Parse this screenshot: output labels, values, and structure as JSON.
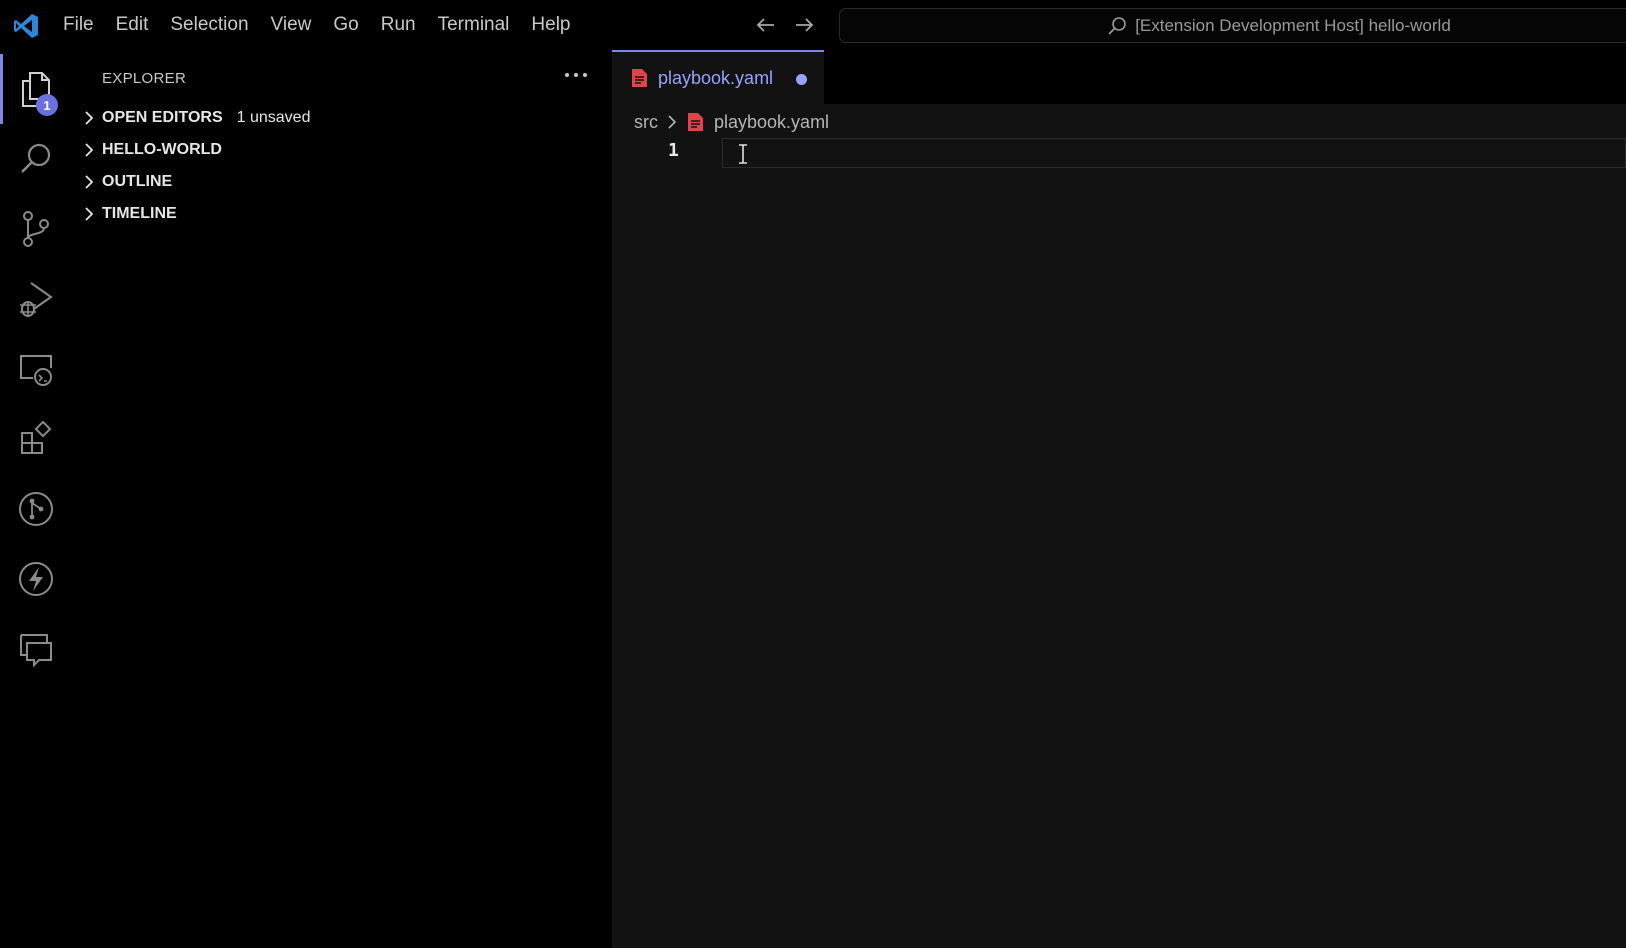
{
  "menu": {
    "items": [
      "File",
      "Edit",
      "Selection",
      "View",
      "Go",
      "Run",
      "Terminal",
      "Help"
    ]
  },
  "command_center": {
    "text": "[Extension Development Host] hello-world",
    "icon": "search-icon"
  },
  "activity_bar": {
    "items": [
      {
        "icon": "explorer-icon",
        "active": true,
        "badge": "1"
      },
      {
        "icon": "search-icon"
      },
      {
        "icon": "source-control-icon"
      },
      {
        "icon": "run-debug-icon"
      },
      {
        "icon": "remote-explorer-icon"
      },
      {
        "icon": "extensions-icon"
      },
      {
        "icon": "git-graph-icon"
      },
      {
        "icon": "lightning-icon"
      },
      {
        "icon": "chat-icon"
      }
    ]
  },
  "sidebar": {
    "title": "EXPLORER",
    "sections": [
      {
        "title": "OPEN EDITORS",
        "extra": "1 unsaved"
      },
      {
        "title": "HELLO-WORLD",
        "extra": ""
      },
      {
        "title": "OUTLINE",
        "extra": ""
      },
      {
        "title": "TIMELINE",
        "extra": ""
      }
    ]
  },
  "editor": {
    "tab": {
      "label": "playbook.yaml",
      "dirty": true
    },
    "breadcrumb": {
      "folder": "src",
      "file": "playbook.yaml"
    },
    "line_numbers": [
      "1"
    ]
  },
  "colors": {
    "accent": "#7e86e8",
    "tab_label": "#9aa2ff",
    "yaml_icon": "#e0434a",
    "logo": "#2f86d8"
  }
}
